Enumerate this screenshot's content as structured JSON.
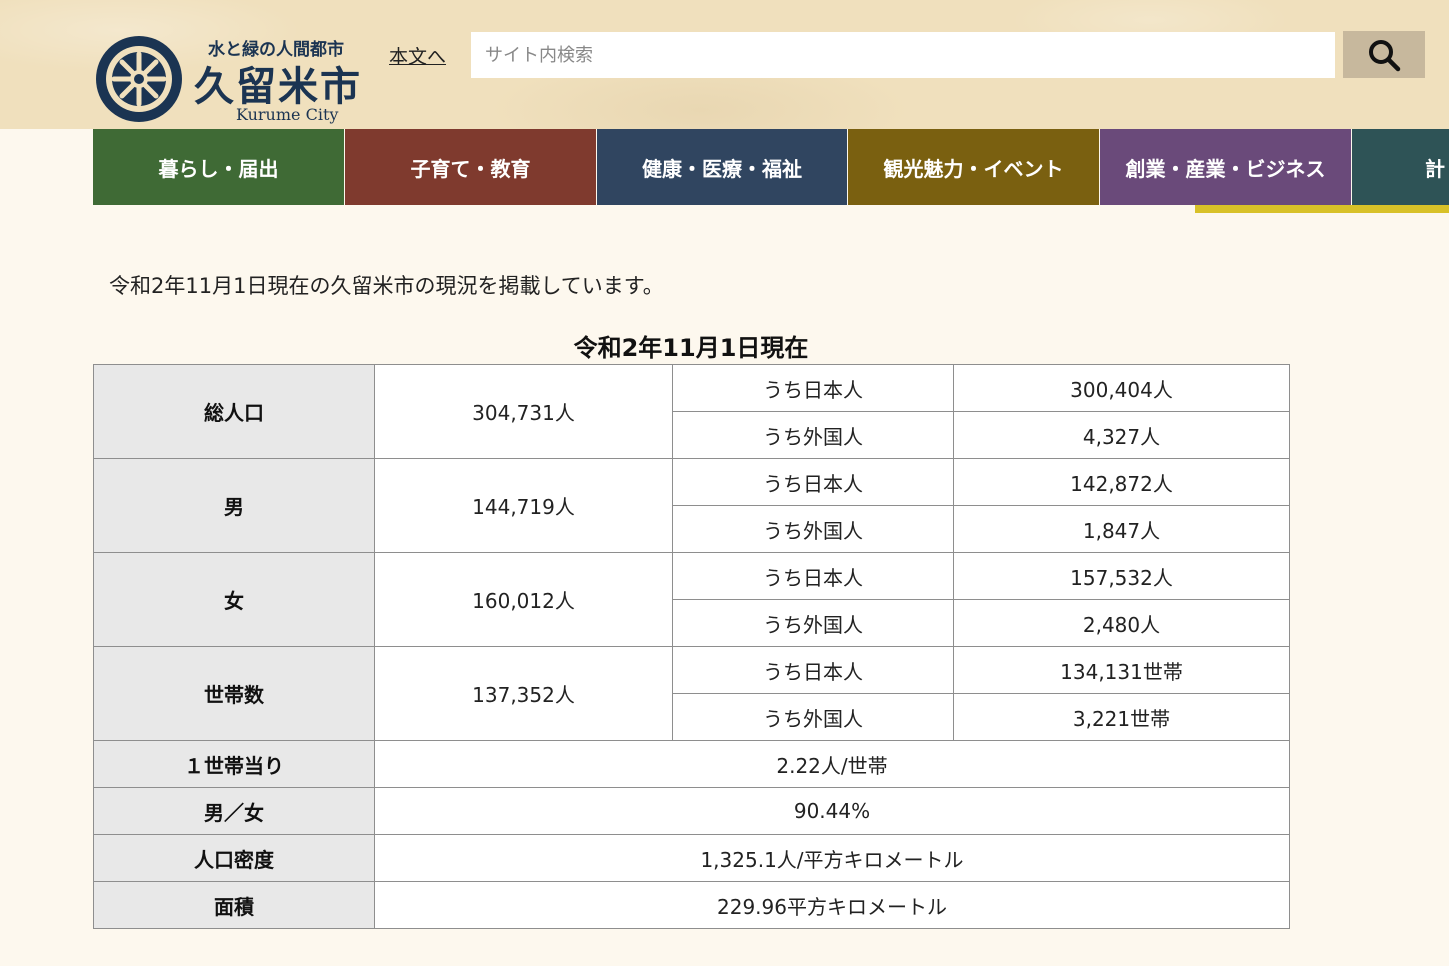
{
  "header": {
    "logo": {
      "tagline": "水と緑の人間都市",
      "name": "久留米市",
      "name_en": "Kurume City"
    },
    "skip_link": "本文へ",
    "search": {
      "placeholder": "サイト内検索"
    }
  },
  "nav": {
    "items": [
      {
        "label": "暮らし・届出",
        "color": "#3f6a35"
      },
      {
        "label": "子育て・教育",
        "color": "#7f3a2e"
      },
      {
        "label": "健康・医療・福祉",
        "color": "#304560"
      },
      {
        "label": "観光魅力・イベント",
        "color": "#7a6010"
      },
      {
        "label": "創業・産業・ビジネス",
        "color": "#6a4a7a"
      },
      {
        "label": "計",
        "color": "#2e5356"
      }
    ],
    "active_bar_color": "#d8c128"
  },
  "content": {
    "intro": "令和2年11月1日現在の久留米市の現況を掲載しています。",
    "table": {
      "caption": "令和2年11月1日現在",
      "groups": [
        {
          "label": "総人口",
          "total": "304,731人",
          "rows": [
            {
              "sub": "うち日本人",
              "value": "300,404人"
            },
            {
              "sub": "うち外国人",
              "value": "4,327人"
            }
          ]
        },
        {
          "label": "男",
          "total": "144,719人",
          "rows": [
            {
              "sub": "うち日本人",
              "value": "142,872人"
            },
            {
              "sub": "うち外国人",
              "value": "1,847人"
            }
          ]
        },
        {
          "label": "女",
          "total": "160,012人",
          "rows": [
            {
              "sub": "うち日本人",
              "value": "157,532人"
            },
            {
              "sub": "うち外国人",
              "value": "2,480人"
            }
          ]
        },
        {
          "label": "世帯数",
          "total": "137,352人",
          "rows": [
            {
              "sub": "うち日本人",
              "value": "134,131世帯"
            },
            {
              "sub": "うち外国人",
              "value": "3,221世帯"
            }
          ]
        }
      ],
      "singles": [
        {
          "label": "１世帯当り",
          "value": "2.22人/世帯"
        },
        {
          "label": "男／女",
          "value": "90.44%"
        },
        {
          "label": "人口密度",
          "value": "1,325.1人/平方キロメートル"
        },
        {
          "label": "面積",
          "value": "229.96平方キロメートル"
        }
      ]
    }
  }
}
